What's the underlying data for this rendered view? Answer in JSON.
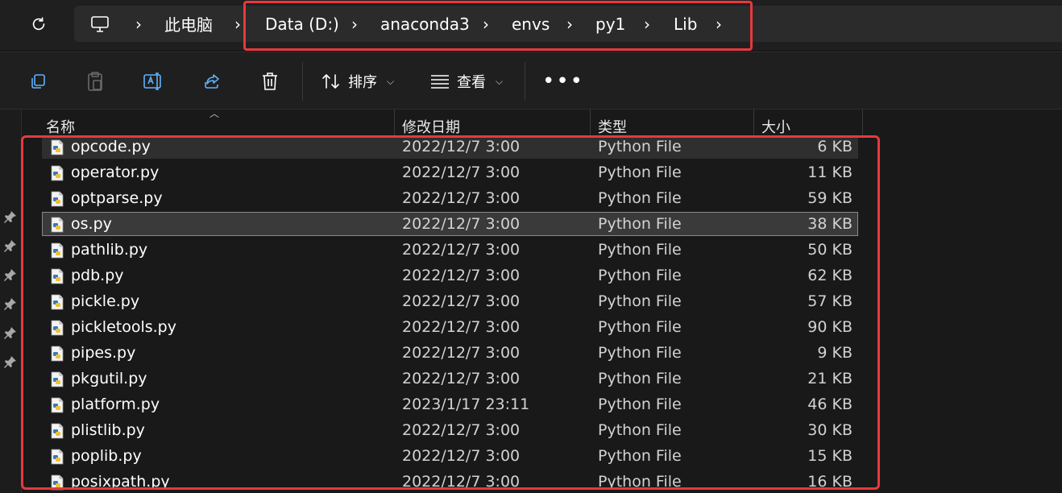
{
  "address_bar": {
    "crumbs": [
      "此电脑",
      "Data (D:)",
      "anaconda3",
      "envs",
      "py1",
      "Lib"
    ],
    "separator": "›",
    "home_icon": "monitor-icon",
    "refresh_icon": "refresh-icon"
  },
  "toolbar": {
    "icons": [
      "copy-icon",
      "paste-icon",
      "rename-icon",
      "share-icon",
      "delete-icon"
    ],
    "sort_label": "排序",
    "view_label": "查看",
    "more_label": "•••"
  },
  "columns": {
    "name": "名称",
    "date": "修改日期",
    "type": "类型",
    "size": "大小"
  },
  "files": [
    {
      "name": "opcode.py",
      "date": "2022/12/7 3:00",
      "type": "Python File",
      "size": "6 KB"
    },
    {
      "name": "operator.py",
      "date": "2022/12/7 3:00",
      "type": "Python File",
      "size": "11 KB"
    },
    {
      "name": "optparse.py",
      "date": "2022/12/7 3:00",
      "type": "Python File",
      "size": "59 KB"
    },
    {
      "name": "os.py",
      "date": "2022/12/7 3:00",
      "type": "Python File",
      "size": "38 KB"
    },
    {
      "name": "pathlib.py",
      "date": "2022/12/7 3:00",
      "type": "Python File",
      "size": "50 KB"
    },
    {
      "name": "pdb.py",
      "date": "2022/12/7 3:00",
      "type": "Python File",
      "size": "62 KB"
    },
    {
      "name": "pickle.py",
      "date": "2022/12/7 3:00",
      "type": "Python File",
      "size": "57 KB"
    },
    {
      "name": "pickletools.py",
      "date": "2022/12/7 3:00",
      "type": "Python File",
      "size": "90 KB"
    },
    {
      "name": "pipes.py",
      "date": "2022/12/7 3:00",
      "type": "Python File",
      "size": "9 KB"
    },
    {
      "name": "pkgutil.py",
      "date": "2022/12/7 3:00",
      "type": "Python File",
      "size": "21 KB"
    },
    {
      "name": "platform.py",
      "date": "2023/1/17 23:11",
      "type": "Python File",
      "size": "46 KB"
    },
    {
      "name": "plistlib.py",
      "date": "2022/12/7 3:00",
      "type": "Python File",
      "size": "30 KB"
    },
    {
      "name": "poplib.py",
      "date": "2022/12/7 3:00",
      "type": "Python File",
      "size": "15 KB"
    },
    {
      "name": "posixpath.py",
      "date": "2022/12/7 3:00",
      "type": "Python File",
      "size": "16 KB"
    }
  ],
  "selected_file": "os.py",
  "colors": {
    "highlight": "#e8383d",
    "background": "#191919",
    "selection": "#3a3a3a"
  }
}
